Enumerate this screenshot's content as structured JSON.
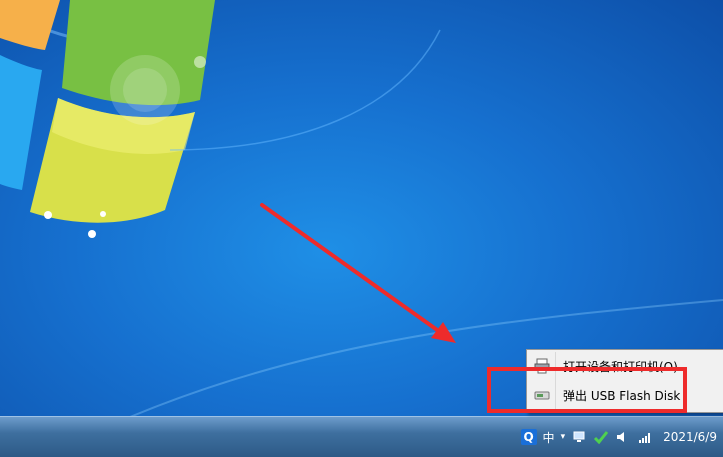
{
  "taskbar": {
    "ime_badge": "Q",
    "ime_lang": "中",
    "tray_expand": "▾",
    "clock_date": "2021/6/9"
  },
  "context_menu": {
    "items": [
      {
        "label": "打开设备和打印机(O)",
        "icon": "printer-icon"
      },
      {
        "label": "弹出 USB Flash Disk",
        "icon": "usb-drive-icon"
      }
    ]
  },
  "annotations": {
    "highlight_color": "#ee2b2b",
    "arrow_color": "#ee2b2b"
  }
}
